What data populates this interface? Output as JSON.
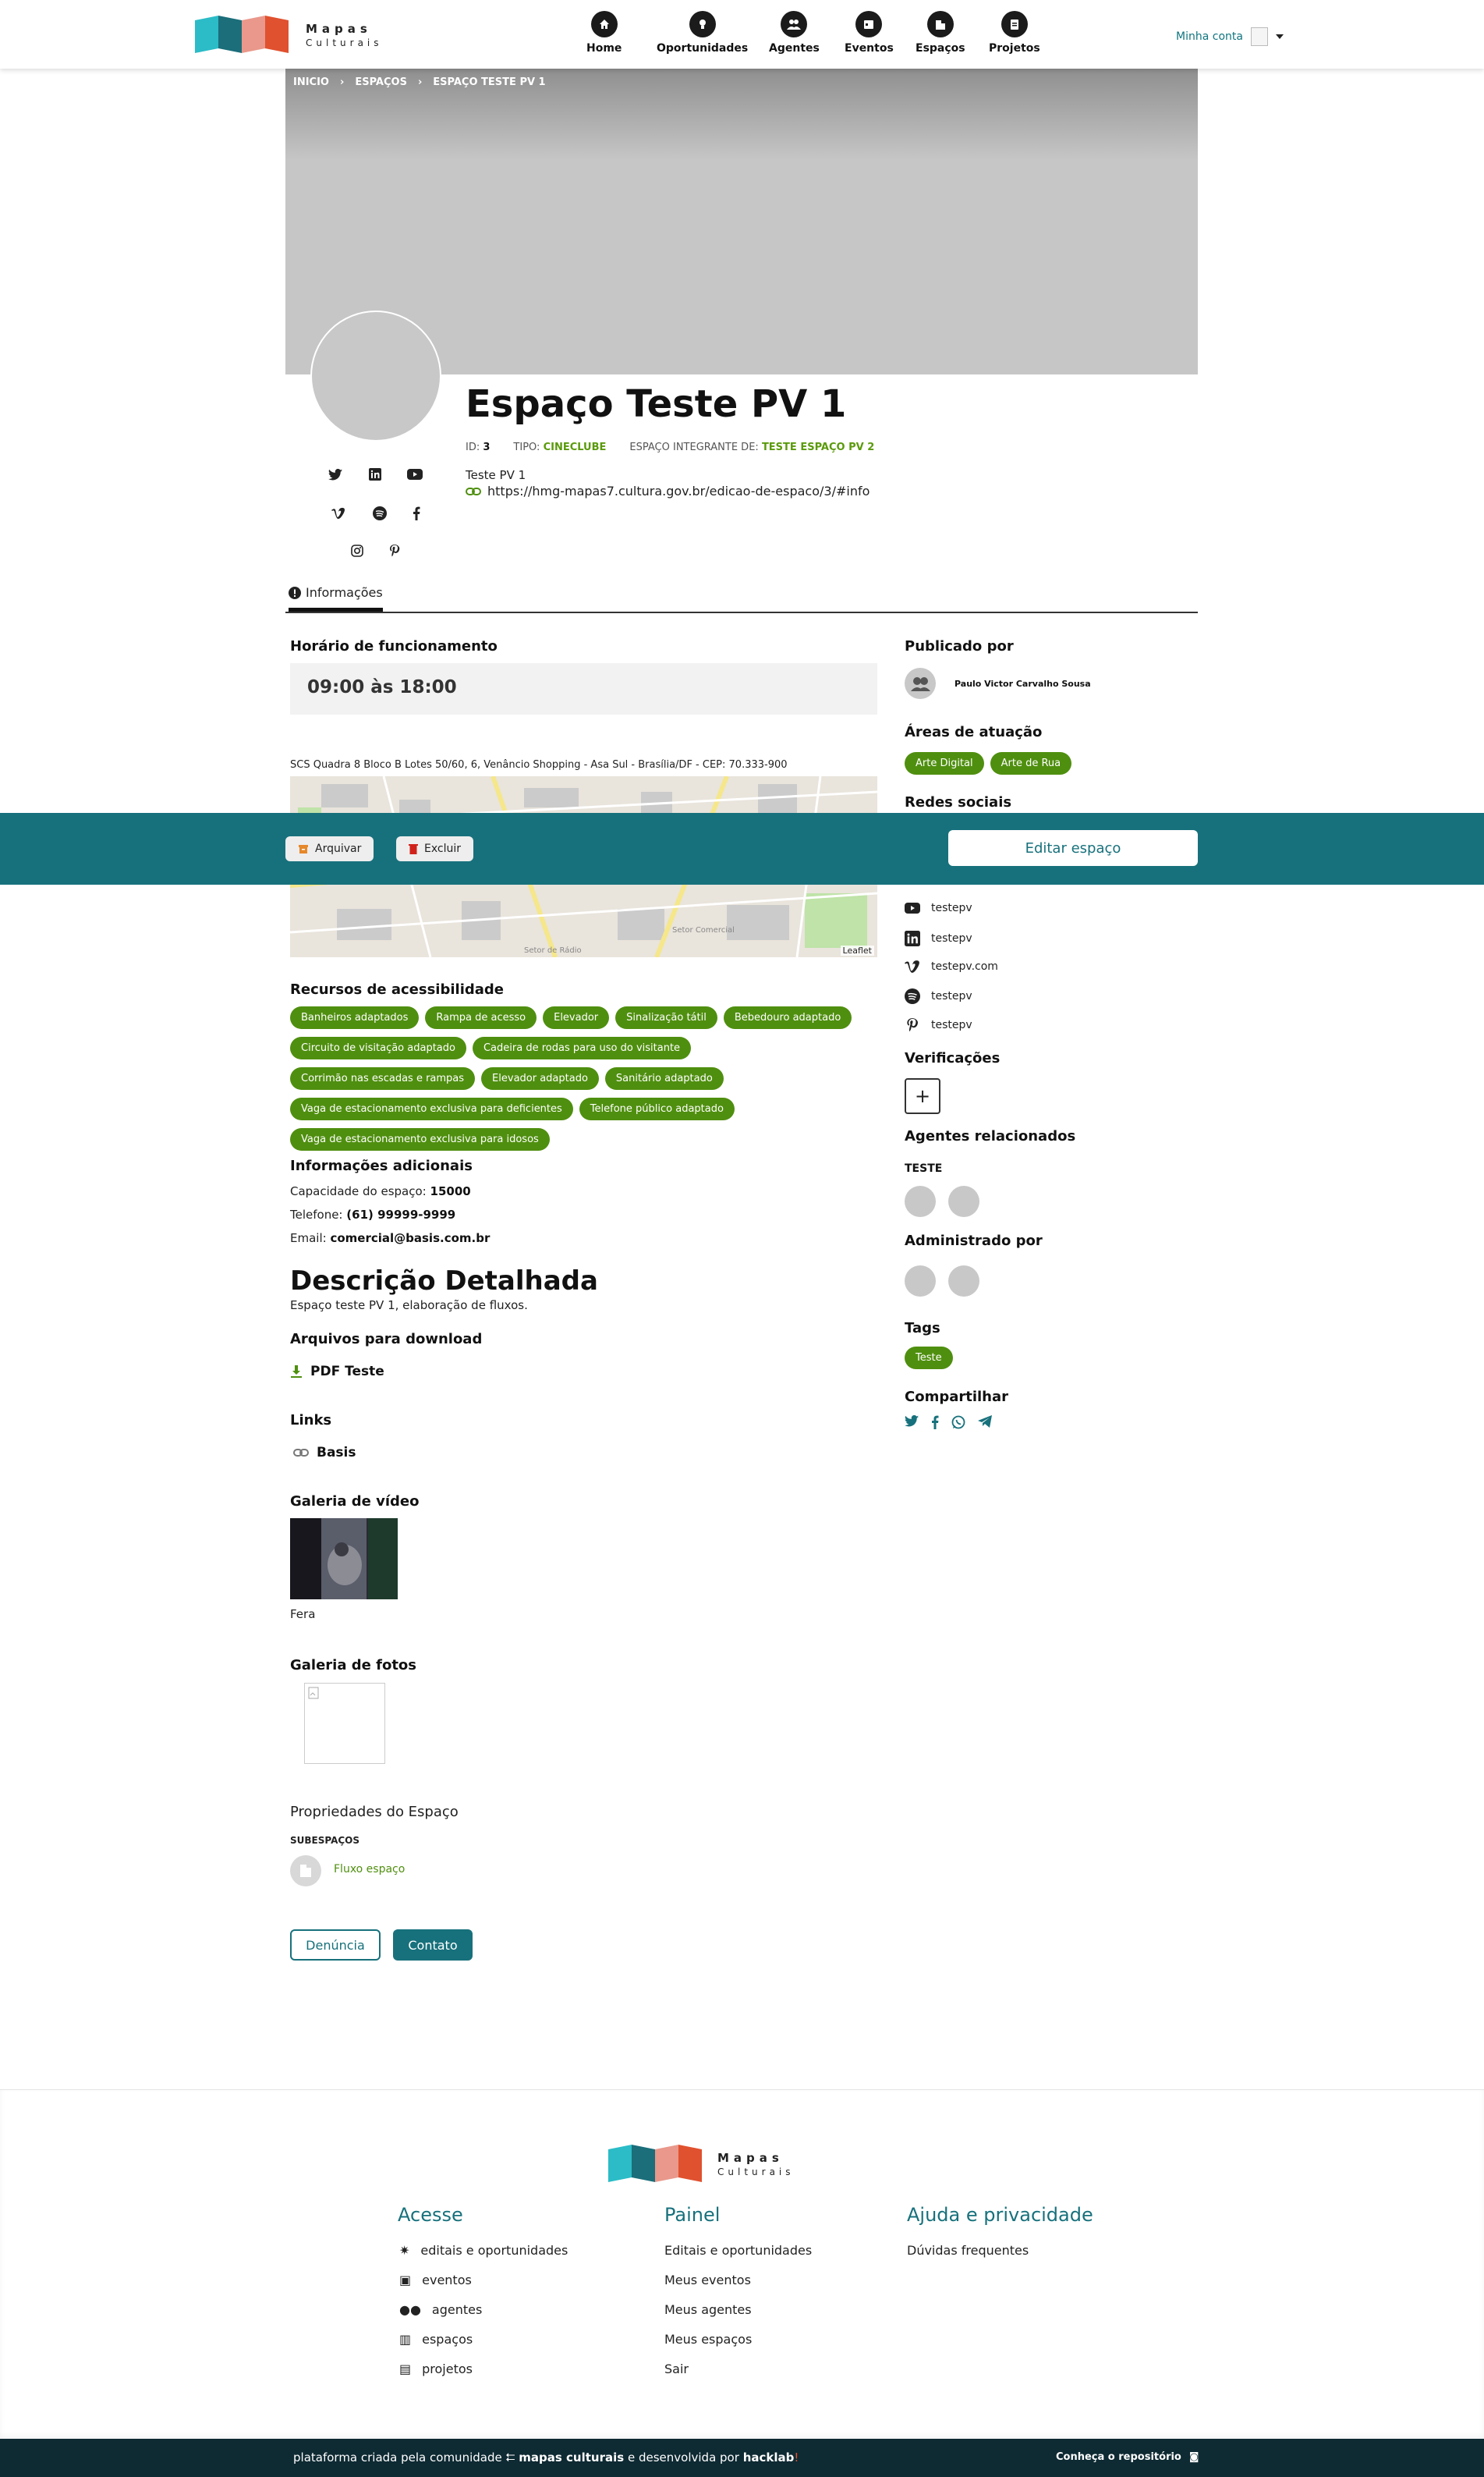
{
  "header": {
    "logo": {
      "line1": "Mapas",
      "line2": "Culturais"
    },
    "nav": [
      {
        "label": "Home",
        "icon": "home-icon"
      },
      {
        "label": "Oportunidades",
        "icon": "lightbulb-icon"
      },
      {
        "label": "Agentes",
        "icon": "agents-icon"
      },
      {
        "label": "Eventos",
        "icon": "calendar-icon"
      },
      {
        "label": "Espaços",
        "icon": "building-icon"
      },
      {
        "label": "Projetos",
        "icon": "clipboard-icon"
      }
    ],
    "account_label": "Minha conta"
  },
  "breadcrumb": [
    "INICIO",
    "ESPAÇOS",
    "ESPAÇO TESTE PV 1"
  ],
  "entity": {
    "title": "Espaço Teste PV 1",
    "id_label": "ID:",
    "id_value": "3",
    "type_label": "TIPO:",
    "type_value": "CINECLUBE",
    "parent_label": "ESPAÇO INTEGRANTE DE:",
    "parent_value": "TESTE ESPAÇO PV 2",
    "short_description": "Teste PV 1",
    "site": "https://hmg-mapas7.cultura.gov.br/edicao-de-espaco/3/#info",
    "social_icons": [
      "twitter-icon",
      "linkedin-icon",
      "youtube-icon",
      "vimeo-icon",
      "spotify-icon",
      "facebook-icon",
      "instagram-icon",
      "pinterest-icon"
    ]
  },
  "tabs": [
    {
      "label": "Informações"
    }
  ],
  "main": {
    "hours_heading": "Horário de funcionamento",
    "hours": "09:00 às 18:00",
    "address": "SCS Quadra 8 Bloco B Lotes 50/60, 6, Venâncio Shopping - Asa Sul - Brasília/DF - CEP: 70.333-900",
    "map_attribution": "Leaflet",
    "map_labels": [
      "Setor Comercial",
      "Setor de Rádio"
    ],
    "accessibility_heading": "Recursos de acessibilidade",
    "accessibility": [
      "Banheiros adaptados",
      "Rampa de acesso",
      "Elevador",
      "Sinalização tátil",
      "Bebedouro adaptado",
      "Circuito de visitação adaptado",
      "Cadeira de rodas para uso do visitante",
      "Corrimão nas escadas e rampas",
      "Elevador adaptado",
      "Sanitário adaptado",
      "Vaga de estacionamento exclusiva para deficientes",
      "Telefone público adaptado",
      "Vaga de estacionamento exclusiva para idosos"
    ],
    "additional_heading": "Informações adicionais",
    "capacity_label": "Capacidade do espaço:",
    "capacity_value": "15000",
    "phone_label": "Telefone:",
    "phone_value": "(61) 99999-9999",
    "email_label": "Email:",
    "email_value": "comercial@basis.com.br",
    "description_heading": "Descrição Detalhada",
    "description": "Espaço teste PV 1, elaboração de fluxos.",
    "downloads_heading": "Arquivos para download",
    "download_item": "PDF Teste",
    "links_heading": "Links",
    "link_item": "Basis",
    "video_heading": "Galeria de vídeo",
    "video_caption": "Fera",
    "photos_heading": "Galeria de fotos",
    "properties_heading": "Propriedades do Espaço",
    "subspaces_label": "SUBESPAÇOS",
    "subspace_item": "Fluxo espaço",
    "report_button": "Denúncia",
    "contact_button": "Contato"
  },
  "sidebar": {
    "published_heading": "Publicado por",
    "publisher": "Paulo Victor Carvalho Sousa",
    "areas_heading": "Áreas de atuação",
    "areas": [
      "Arte Digital",
      "Arte de Rua"
    ],
    "social_heading": "Redes sociais",
    "socials": [
      {
        "icon": "youtube-icon",
        "label": "testepv"
      },
      {
        "icon": "linkedin-icon",
        "label": "testepv"
      },
      {
        "icon": "vimeo-icon",
        "label": "testepv.com"
      },
      {
        "icon": "spotify-icon",
        "label": "testepv"
      },
      {
        "icon": "pinterest-icon",
        "label": "testepv"
      }
    ],
    "verifications_heading": "Verificações",
    "related_heading": "Agentes relacionados",
    "related_group": "TESTE",
    "admin_heading": "Administrado por",
    "tags_heading": "Tags",
    "tags": [
      "Teste"
    ],
    "share_heading": "Compartilhar"
  },
  "actionbar": {
    "archive": "Arquivar",
    "delete": "Excluir",
    "edit": "Editar espaço"
  },
  "footer": {
    "logo": {
      "line1": "Mapas",
      "line2": "Culturais"
    },
    "col1": {
      "heading": "Acesse",
      "items": [
        "editais e oportunidades",
        "eventos",
        "agentes",
        "espaços",
        "projetos"
      ]
    },
    "col2": {
      "heading": "Painel",
      "items": [
        "Editais e oportunidades",
        "Meus eventos",
        "Meus agentes",
        "Meus espaços",
        "Sair"
      ]
    },
    "col3": {
      "heading": "Ajuda e privacidade",
      "items": [
        "Dúvidas frequentes"
      ]
    },
    "bar": {
      "part1": "plataforma criada pela comunidade",
      "brand": "mapas culturais",
      "part2": "e desenvolvida por",
      "dev": "hacklab",
      "repo": "Conheça o repositório"
    }
  },
  "colors": {
    "primary": "#17717c",
    "green": "#4f8f0f",
    "dark": "#0e2a33"
  }
}
